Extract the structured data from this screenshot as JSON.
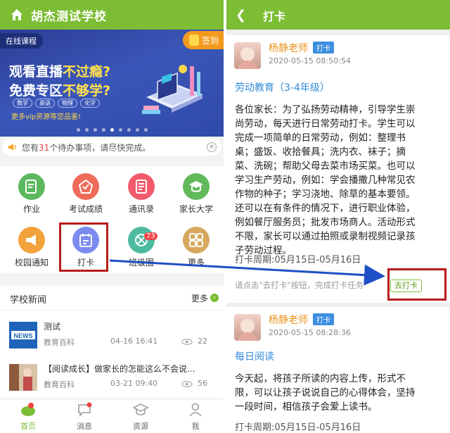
{
  "left": {
    "header_title": "胡杰测试学校",
    "banner": {
      "online_tag": "在线课程",
      "checkin_label": "签到",
      "line1_a": "观看直播",
      "line1_b": "不过瘾?",
      "line2_a": "免费专区",
      "line2_b": "不够学?",
      "subjects": [
        "数学",
        "英语",
        "物理",
        "化学"
      ],
      "promo": "更多vip资源等您品鉴!"
    },
    "todo": {
      "prefix": "您有",
      "count": "31",
      "suffix": "个待办事项，请尽快完成。"
    },
    "grid": [
      {
        "label": "作业",
        "icon": "homework-icon",
        "color": "#5bb85d"
      },
      {
        "label": "考试成绩",
        "icon": "exam-icon",
        "color": "#f06a5a"
      },
      {
        "label": "通讯录",
        "icon": "contacts-icon",
        "color": "#f35b6d"
      },
      {
        "label": "家长大学",
        "icon": "graduation-icon",
        "color": "#62b95b"
      },
      {
        "label": "校园通知",
        "icon": "megaphone-icon",
        "color": "#f2a23a"
      },
      {
        "label": "打卡",
        "icon": "checkin-icon",
        "color": "#7b8bf0"
      },
      {
        "label": "班级圈",
        "icon": "class-circle-icon",
        "color": "#4dbba0"
      },
      {
        "label": "更多",
        "icon": "more-grid-icon",
        "color": "#d7a85c"
      }
    ],
    "class_badge": "73",
    "news": {
      "title": "学校新闻",
      "more": "更多",
      "items": [
        {
          "title": "测试",
          "source": "教育百科",
          "date": "04-16 16:41",
          "views": "22"
        },
        {
          "title": "【阅读成长】做家长的怎能这么不会说...",
          "source": "教育百科",
          "date": "03-21 09:40",
          "views": "56"
        }
      ]
    },
    "tabs": [
      {
        "label": "首页",
        "icon": "home-icon",
        "active": true
      },
      {
        "label": "消息",
        "icon": "message-icon",
        "active": false
      },
      {
        "label": "资源",
        "icon": "resource-icon",
        "active": false
      },
      {
        "label": "我",
        "icon": "profile-icon",
        "active": false
      }
    ]
  },
  "right": {
    "header_title": "打卡",
    "cards": [
      {
        "teacher": "杨静老师",
        "tag": "打卡",
        "time": "2020-05-15 08:50:54",
        "title": "劳动教育（3-4年级）",
        "body_lines": [
          "各位家长：为了弘扬劳动精神，引导学生崇",
          "尚劳动，每天进行日常劳动打卡。学生可以",
          "完成一项简单的日常劳动，例如：整理书",
          "桌；盛饭、收拾餐具；洗内衣、袜子；摘",
          "菜、洗碗；帮助父母去菜市场买菜。也可以",
          "学习生产劳动，例如：学会播撒几种常见农",
          "作物的种子；学习浇地、除草的基本要领。",
          "还可以在有条件的情况下，进行职业体验，",
          "例如餐厅服务员；批发市场商人。活动形式",
          "不限，家长可以通过拍照或录制视频记录孩",
          "子劳动过程。"
        ],
        "period": "打卡周期:05月15日-05月16日",
        "hint": "请点击\"去打卡\"按钮，完成打卡任务",
        "action": "去打卡"
      },
      {
        "teacher": "杨静老师",
        "tag": "打卡",
        "time": "2020-05-15 08:28:36",
        "title": "每日阅读",
        "body_lines": [
          "今天起，将孩子所读的内容上传，形式不",
          "限，可以让孩子说说自己的心得体会，坚持",
          "一段时间，相信孩子会爱上读书。"
        ],
        "period": "打卡周期:05月15日-05月16日"
      }
    ]
  },
  "colors": {
    "brand_green": "#7cbd34",
    "highlight_red": "#b71c1c",
    "arrow_blue": "#1f4fc6"
  }
}
